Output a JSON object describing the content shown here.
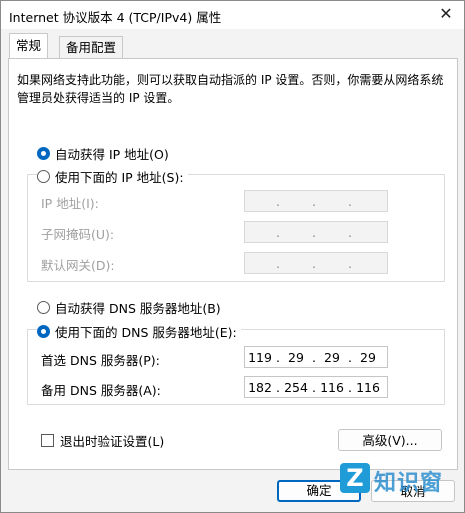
{
  "window": {
    "title": "Internet 协议版本 4 (TCP/IPv4) 属性",
    "close_glyph": "✕"
  },
  "tabs": [
    {
      "label": "常规"
    },
    {
      "label": "备用配置"
    }
  ],
  "description": "如果网络支持此功能，则可以获取自动指派的 IP 设置。否则，你需要从网络系统管理员处获得适当的 IP 设置。",
  "ip": {
    "auto_label": "自动获得 IP 地址(O)",
    "manual_label": "使用下面的 IP 地址(S):",
    "auto_selected": true,
    "fields": [
      {
        "label": "IP 地址(I):",
        "octets": [
          "",
          "",
          "",
          ""
        ]
      },
      {
        "label": "子网掩码(U):",
        "octets": [
          "",
          "",
          "",
          ""
        ]
      },
      {
        "label": "默认网关(D):",
        "octets": [
          "",
          "",
          "",
          ""
        ]
      }
    ]
  },
  "dns": {
    "auto_label": "自动获得 DNS 服务器地址(B)",
    "manual_label": "使用下面的 DNS 服务器地址(E):",
    "manual_selected": true,
    "fields": [
      {
        "label": "首选 DNS 服务器(P):",
        "octets": [
          "119",
          "29",
          "29",
          "29"
        ]
      },
      {
        "label": "备用 DNS 服务器(A):",
        "octets": [
          "182",
          "254",
          "116",
          "116"
        ]
      }
    ]
  },
  "validate_label": "退出时验证设置(L)",
  "advanced_label": "高级(V)...",
  "ok_label": "确定",
  "cancel_label": "取消",
  "watermark": {
    "mark": "Z",
    "text": "知识窗"
  }
}
